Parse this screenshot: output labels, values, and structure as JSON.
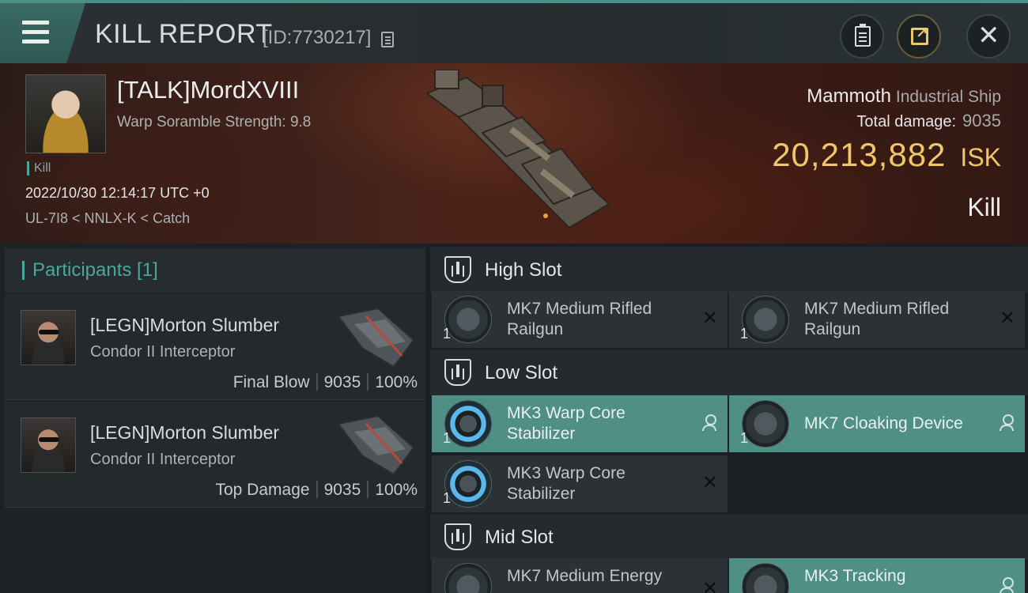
{
  "header": {
    "title": "KILL REPORT",
    "report_id": "[ID:7730217]"
  },
  "victim": {
    "name": "[TALK]MordXVIII",
    "warp_scramble": "Warp Soramble Strength: 9.8",
    "tag": "Kill",
    "datetime": "2022/10/30 12:14:17 UTC +0",
    "location": "UL-7I8 < NNLX-K < Catch",
    "ship_name": "Mammoth",
    "ship_class": "Industrial Ship",
    "total_damage_label": "Total damage:",
    "total_damage": "9035",
    "isk_value": "20,213,882",
    "isk_unit": "ISK",
    "result": "Kill"
  },
  "participants": {
    "header": "Participants [1]",
    "rows": [
      {
        "name": "[LEGN]Morton Slumber",
        "ship": "Condor II Interceptor",
        "role": "Final Blow",
        "damage": "9035",
        "percent": "100%"
      },
      {
        "name": "[LEGN]Morton Slumber",
        "ship": "Condor II Interceptor",
        "role": "Top Damage",
        "damage": "9035",
        "percent": "100%"
      }
    ]
  },
  "fitting": {
    "high": {
      "title": "High Slot",
      "modules": [
        {
          "qty": "1",
          "line1": "MK7 Medium Rifled",
          "line2": "Railgun",
          "status": "destroyed"
        },
        {
          "qty": "1",
          "line1": "MK7 Medium Rifled",
          "line2": "Railgun",
          "status": "destroyed"
        }
      ]
    },
    "low": {
      "title": "Low Slot",
      "modules": [
        {
          "qty": "1",
          "line1": "MK3 Warp Core",
          "line2": "Stabilizer",
          "status": "dropped"
        },
        {
          "qty": "1",
          "line1": "MK7 Cloaking Device",
          "status": "dropped"
        },
        {
          "qty": "1",
          "line1": "MK3 Warp Core",
          "line2": "Stabilizer",
          "status": "destroyed"
        }
      ]
    },
    "mid": {
      "title": "Mid Slot",
      "modules": [
        {
          "line1": "MK7 Medium Energy",
          "status": "destroyed"
        },
        {
          "line1": "MK3 Tracking",
          "status": "dropped"
        }
      ]
    }
  },
  "colors": {
    "accent": "#4aa89a",
    "isk": "#f1c766",
    "fitted_bg": "#4f8f86"
  }
}
